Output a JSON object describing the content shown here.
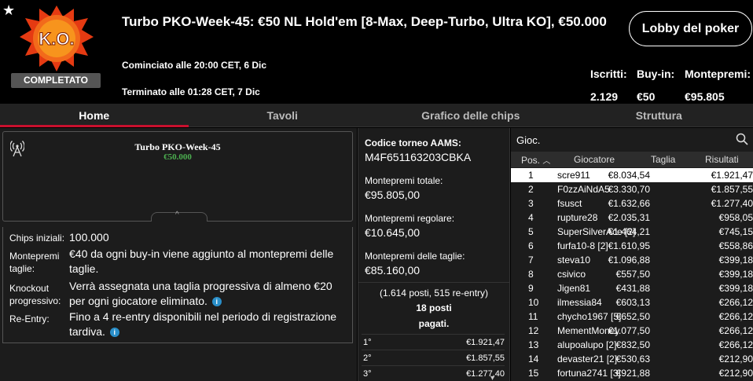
{
  "header": {
    "title": "Turbo PKO-Week-45: €50 NL Hold'em [8-Max, Deep-Turbo, Ultra KO], €50.000",
    "logo_text": "K.O.",
    "status_badge": "COMPLETATO",
    "started": "Cominciato alle 20:00 CET, 6 Dic",
    "ended": "Terminato alle 01:28 CET, 7 Dic",
    "lobby_button": "Lobby del poker",
    "stats": [
      {
        "label": "Iscritti:",
        "value": "2.129"
      },
      {
        "label": "Buy-in:",
        "value": "€50"
      },
      {
        "label": "Montepremi:",
        "value": "€95.805"
      }
    ]
  },
  "tabs": [
    {
      "label": "Home",
      "active": true
    },
    {
      "label": "Tavoli",
      "active": false
    },
    {
      "label": "Grafico delle chips",
      "active": false
    },
    {
      "label": "Struttura",
      "active": false
    }
  ],
  "banner": {
    "name": "Turbo PKO-Week-45",
    "prize": "€50.000",
    "icon": "antenna-icon"
  },
  "info": [
    {
      "label": "Chips iniziali:",
      "value": "100.000",
      "info_icon": false
    },
    {
      "label": "Montepremi taglie:",
      "value": "€40 da ogni buy-in viene aggiunto al montepremi delle taglie.",
      "info_icon": false
    },
    {
      "label": "Knockout progressivo:",
      "value": "Verrà assegnata una taglia progressiva di almeno €20 per ogni giocatore eliminato.",
      "info_icon": true
    },
    {
      "label": "Re-Entry:",
      "value": "Fino a 4 re-entry disponibili nel periodo di registrazione tardiva.",
      "info_icon": true
    }
  ],
  "middle": {
    "aams_label": "Codice torneo AAMS:",
    "aams_code": "M4F651163203CBKA",
    "total_label": "Montepremi totale:",
    "total_value": "€95.805,00",
    "regular_label": "Montepremi regolare:",
    "regular_value": "€10.645,00",
    "bounty_label": "Montepremi delle taglie:",
    "bounty_value": "€85.160,00",
    "entries_note": "(1.614 posti, 515 re-entry)",
    "paid_places": "18 posti",
    "paid_label": "pagati.",
    "prizes": [
      {
        "place": "1°",
        "amount": "€1.921,47"
      },
      {
        "place": "2°",
        "amount": "€1.857,55"
      },
      {
        "place": "3°",
        "amount": "€1.277,40"
      }
    ]
  },
  "players": {
    "search_label": "Gioc.",
    "columns": {
      "pos": "Pos.",
      "player": "Giocatore",
      "bounty": "Taglia",
      "result": "Risultati"
    },
    "rows": [
      {
        "pos": "1",
        "player": "scre911",
        "bounty": "€8.034,54",
        "result": "€1.921,47",
        "selected": true
      },
      {
        "pos": "2",
        "player": "F0zzAiNdA5",
        "bounty": "€3.330,70",
        "result": "€1.857,55"
      },
      {
        "pos": "3",
        "player": "fsusct",
        "bounty": "€1.632,66",
        "result": "€1.277,40"
      },
      {
        "pos": "4",
        "player": "rupture28",
        "bounty": "€2.035,31",
        "result": "€958,05"
      },
      {
        "pos": "5",
        "player": "SuperSilverAce [2]",
        "bounty": "€1.464,21",
        "result": "€745,15"
      },
      {
        "pos": "6",
        "player": "furfa10-8 [2]",
        "bounty": "€1.610,95",
        "result": "€558,86"
      },
      {
        "pos": "7",
        "player": "steva10",
        "bounty": "€1.096,88",
        "result": "€399,18"
      },
      {
        "pos": "8",
        "player": "csivico",
        "bounty": "€557,50",
        "result": "€399,18"
      },
      {
        "pos": "9",
        "player": "Jigen81",
        "bounty": "€431,88",
        "result": "€399,18"
      },
      {
        "pos": "10",
        "player": "ilmessia84",
        "bounty": "€603,13",
        "result": "€266,12"
      },
      {
        "pos": "11",
        "player": "chycho1967 [5]",
        "bounty": "€652,50",
        "result": "€266,12"
      },
      {
        "pos": "12",
        "player": "MementMoney",
        "bounty": "€1.077,50",
        "result": "€266,12"
      },
      {
        "pos": "13",
        "player": "alupoalupo [2]",
        "bounty": "€832,50",
        "result": "€266,12"
      },
      {
        "pos": "14",
        "player": "devaster21 [2]",
        "bounty": "€530,63",
        "result": "€212,90"
      },
      {
        "pos": "15",
        "player": "fortuna2741 [3]",
        "bounty": "€921,88",
        "result": "€212,90"
      }
    ]
  },
  "colors": {
    "accent": "#c8102e",
    "prize_green": "#4caf50",
    "info_blue": "#2a8fc9",
    "panel_bg": "#1c1c1c"
  }
}
